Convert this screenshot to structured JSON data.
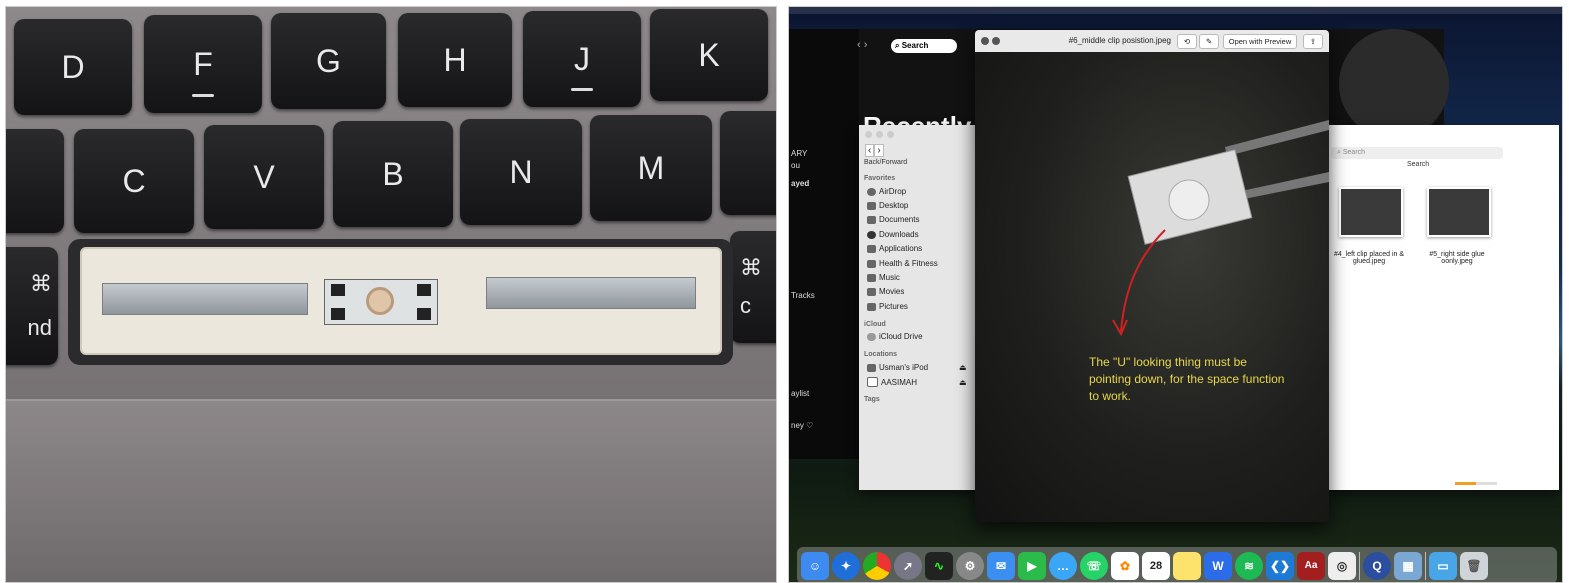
{
  "left_photo": {
    "keys_row1": [
      "D",
      "F",
      "G",
      "H",
      "J",
      "K"
    ],
    "keys_row2": [
      "C",
      "V",
      "B",
      "N",
      "M"
    ],
    "left_edge_keys": [
      "⌘",
      "nd"
    ],
    "right_edge_keys": [
      "⌘",
      "c"
    ]
  },
  "desktop": {
    "music_app": {
      "search_label": "Search",
      "heading": "Recently",
      "sidebar": [
        "ARY",
        "ou",
        "ayed",
        "Tracks",
        "aylist",
        "ney ♡"
      ]
    },
    "finder": {
      "nav_label": "Back/Forward",
      "sections": {
        "favorites": "Favorites",
        "icloud": "iCloud",
        "locations": "Locations",
        "tags": "Tags"
      },
      "favorites_items": [
        "AirDrop",
        "Desktop",
        "Documents",
        "Downloads",
        "Applications",
        "Health & Fitness",
        "Music",
        "Movies",
        "Pictures"
      ],
      "icloud_items": [
        "iCloud Drive"
      ],
      "locations_items": [
        "Usman's iPod",
        "AASIMAH"
      ],
      "search_placeholder": "Search",
      "search_label": "Search",
      "files": [
        {
          "name": "#4_left clip placed in & glued.jpeg"
        },
        {
          "name": "#5_right side glue oonly.jpeg"
        }
      ]
    },
    "quicklook": {
      "title": "#6_middle clip posistion.jpeg",
      "open_with": "Open with Preview",
      "caption": "The \"U\" looking thing must be pointing down, for the space function to work."
    },
    "dock": {
      "calendar_date": "28",
      "icons": [
        "finder-icon",
        "safari-icon",
        "chrome-icon",
        "launchpad-icon",
        "activity-monitor-icon",
        "system-preferences-icon",
        "mail-icon",
        "facetime-icon",
        "messages-icon",
        "whatsapp-icon",
        "photos-icon",
        "calendar-icon",
        "notes-icon",
        "wps-icon",
        "spotify-icon",
        "vscode-icon",
        "dictionary-icon",
        "screenshot-icon",
        "quicktime-icon",
        "preview-icon",
        "folder-icon",
        "trash-icon"
      ]
    }
  },
  "colors": {
    "caption": "#e8d84a",
    "arrow": "#d02020",
    "key": "#1e1e20"
  }
}
